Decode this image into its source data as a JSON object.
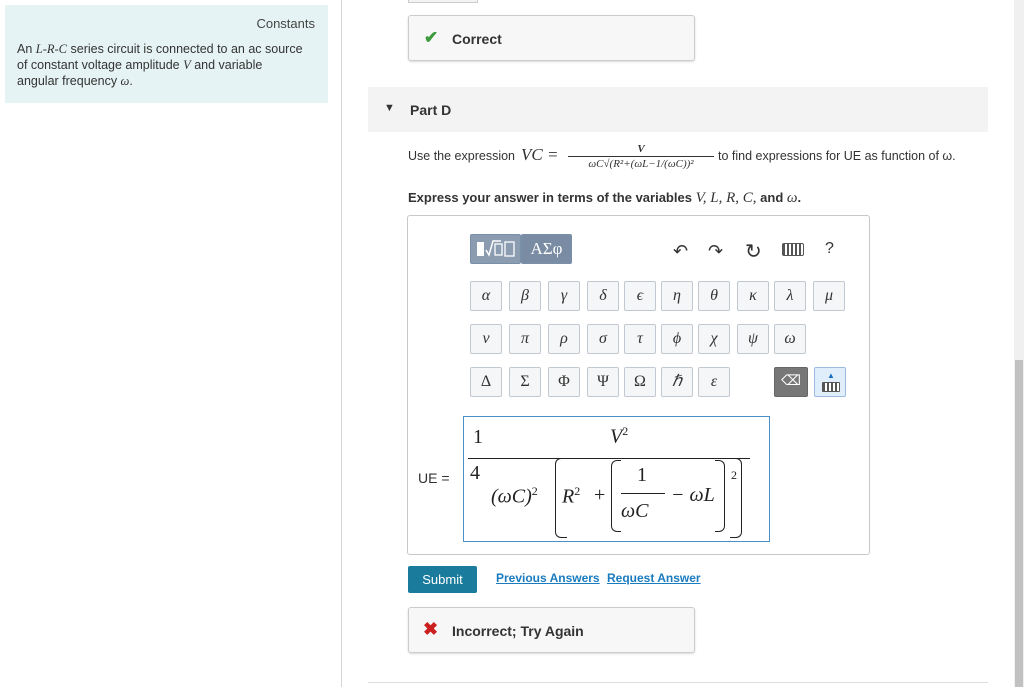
{
  "constants": {
    "title": "Constants",
    "text_a": "An ",
    "lrc": "L-R-C",
    "text_b": " series circuit is connected to an ac source of constant voltage amplitude ",
    "v": "V",
    "text_c": " and variable angular frequency ",
    "omega": "ω",
    "text_d": "."
  },
  "feedback_top": {
    "icon": "✔",
    "label": "Correct"
  },
  "part": {
    "label": "Part D",
    "toggle_icon": "▼"
  },
  "instructions": {
    "prefix": "Use the expression",
    "vc": "VC =",
    "frac_num": "V",
    "frac_den": "ωC√(R²+(ωL−1/(ωC))²",
    "suffix": "to find expressions for UE as function of ω."
  },
  "express": {
    "prefix": "Express your answer in terms of the variables ",
    "vars": "V, L, R, C,",
    "and": " and ",
    "w": "ω",
    "end": "."
  },
  "toolbar": {
    "templates_label": "▮√▭",
    "greek_label": "ΑΣφ",
    "undo_icon": "↶",
    "redo_icon": "↷",
    "reset_icon": "↻",
    "help_label": "?"
  },
  "greek_row1": [
    "α",
    "β",
    "γ",
    "δ",
    "ϵ",
    "η",
    "θ",
    "κ",
    "λ",
    "μ"
  ],
  "greek_row2": [
    "ν",
    "π",
    "ρ",
    "σ",
    "τ",
    "ϕ",
    "χ",
    "ψ",
    "ω"
  ],
  "greek_row3": [
    "Δ",
    "Σ",
    "Φ",
    "Ψ",
    "Ω",
    "ℏ",
    "ε"
  ],
  "keys": {
    "backspace": "⌫"
  },
  "answer": {
    "label": "UE =",
    "coef_num": "1",
    "coef_den": "4",
    "main_num": "V",
    "main_num_exp": "2",
    "den_part": "(ωC)",
    "den_part_exp": "2",
    "r": "R",
    "r_exp": "2",
    "plus": "+",
    "inner_num": "1",
    "inner_den": "ωC",
    "minus_wl": "− ωL",
    "outer_exp": "2"
  },
  "submit_label": "Submit",
  "links": {
    "previous": "Previous Answers",
    "request": "Request Answer"
  },
  "feedback_bottom": {
    "icon": "✖",
    "label": "Incorrect; Try Again"
  }
}
